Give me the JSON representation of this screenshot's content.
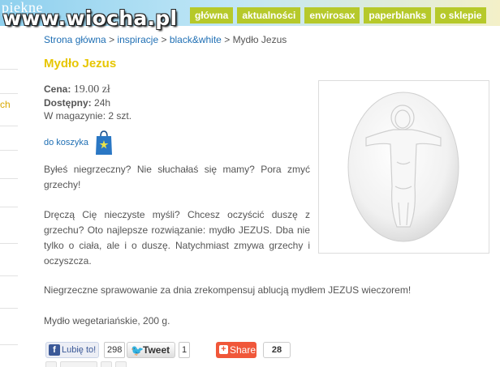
{
  "header": {
    "brand_fragment": "piekne",
    "watermark": "www.wiocha.pl",
    "nav": [
      "główna",
      "aktualności",
      "envirosax",
      "paperblanks",
      "o sklepie"
    ]
  },
  "sidebar": {
    "partial_label": "ch"
  },
  "breadcrumb": {
    "home": "Strona główna",
    "sep": ">",
    "level1": "inspiracje",
    "level2": "black&white",
    "current": "Mydło Jezus"
  },
  "product": {
    "title": "Mydło Jezus",
    "price_label": "Cena:",
    "price_value": "19.00 zł",
    "available_label": "Dostępny:",
    "available_value": "24h",
    "stock_text": "W magazynie: 2 szt.",
    "cart_label": "do koszyka",
    "paragraph1": "Byłeś niegrzeczny? Nie słuchałaś się mamy? Pora zmyć grzechy!",
    "paragraph2": "Dręczą Cię nieczyste myśli? Chcesz oczyścić duszę z grzechu? Oto najlepsze rozwiązanie: mydło JEZUS. Dba nie tylko o ciała, ale i o duszę. Natychmiast zmywa grzechy i oczyszcza.",
    "paragraph3": "Niegrzeczne sprawowanie za dnia zrekompensuj ablucją mydłem JEZUS wieczorem!",
    "paragraph4": "Mydło wegetariańskie, 200 g."
  },
  "social": {
    "fb_label": "Lubię to!",
    "fb_count": "298",
    "tweet_label": "Tweet",
    "tweet_count": "1",
    "share_label": "Share",
    "share_count": "28"
  },
  "colors": {
    "nav_bg": "#b6c92a",
    "title": "#e7c600",
    "link": "#1f6fb4",
    "share_bg": "#f0573a"
  }
}
